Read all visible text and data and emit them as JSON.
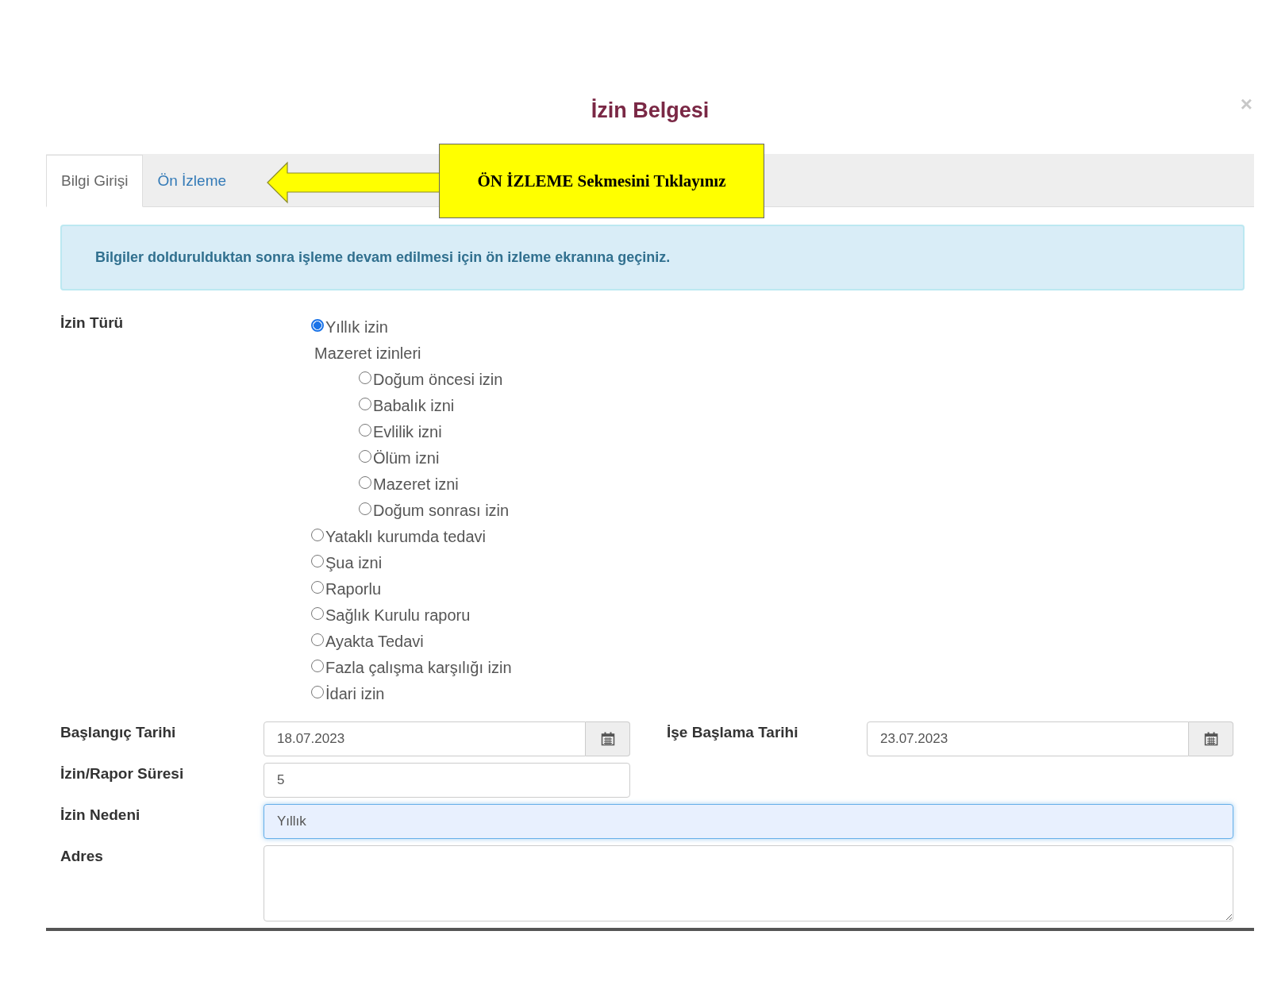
{
  "dialog": {
    "title": "İzin Belgesi",
    "close": "×"
  },
  "tabs": [
    {
      "label": "Bilgi Girişi",
      "selected": true
    },
    {
      "label": "Ön İzleme",
      "selected": false
    }
  ],
  "callout": {
    "text": "ÖN İZLEME Sekmesini Tıklayınız"
  },
  "alert": {
    "text": "Bilgiler doldurulduktan sonra işleme devam edilmesi için ön izleme ekranına geçiniz."
  },
  "leave_type": {
    "label": "İzin Türü",
    "options": [
      {
        "kind": "radio",
        "label": "Yıllık izin",
        "selected": true
      },
      {
        "kind": "group",
        "label": "Mazeret izinleri",
        "children": [
          {
            "kind": "radio",
            "label": "Doğum öncesi izin",
            "selected": false
          },
          {
            "kind": "radio",
            "label": "Babalık izni",
            "selected": false
          },
          {
            "kind": "radio",
            "label": "Evlilik izni",
            "selected": false
          },
          {
            "kind": "radio",
            "label": "Ölüm izni",
            "selected": false
          },
          {
            "kind": "radio",
            "label": "Mazeret izni",
            "selected": false
          },
          {
            "kind": "radio",
            "label": "Doğum sonrası izin",
            "selected": false
          }
        ]
      },
      {
        "kind": "radio",
        "label": "Yataklı kurumda tedavi",
        "selected": false
      },
      {
        "kind": "radio",
        "label": "Şua izni",
        "selected": false
      },
      {
        "kind": "radio",
        "label": "Raporlu",
        "selected": false
      },
      {
        "kind": "radio",
        "label": "Sağlık Kurulu raporu",
        "selected": false
      },
      {
        "kind": "radio",
        "label": "Ayakta Tedavi",
        "selected": false
      },
      {
        "kind": "radio",
        "label": "Fazla çalışma karşılığı izin",
        "selected": false
      },
      {
        "kind": "radio",
        "label": "İdari izin",
        "selected": false
      }
    ]
  },
  "start_date": {
    "label": "Başlangıç Tarihi",
    "value": "18.07.2023"
  },
  "return_date": {
    "label": "İşe Başlama Tarihi",
    "value": "23.07.2023"
  },
  "duration": {
    "label": "İzin/Rapor Süresi",
    "value": "5",
    "focused": false
  },
  "reason": {
    "label": "İzin Nedeni",
    "value": "Yıllık",
    "focused": true
  },
  "address": {
    "label": "Adres"
  }
}
